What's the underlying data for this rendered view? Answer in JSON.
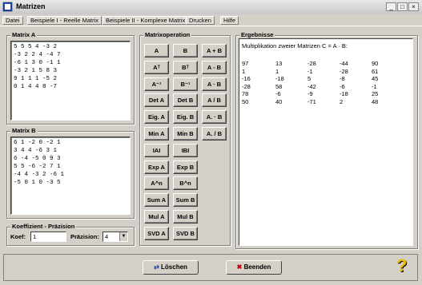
{
  "window": {
    "title": "Matrizen"
  },
  "menu": [
    "Datei",
    "Beispiele I - Reelle Matrix",
    "Beispiele II - Komplexe Matrix",
    "Drucken",
    "Hilfe"
  ],
  "matrix_a": {
    "title": "Matrix A",
    "content": "5 5 5 4 -3 2\n-3 2 2 4 -4 7\n-6 1 3 0 -1 1\n-3 2 1 5 8 3\n9 1 1 1 -5 2\n0 1 4 4 8 -7"
  },
  "matrix_b": {
    "title": "Matrix B",
    "content": "6 1 -2 0 -2 1\n3 4 4 -6 3 1\n6 -4 -5 0 9 3\n5 5 -6 -2 7 1\n-4 4 -3 2 -6 1\n-5 0 1 0 -3 5"
  },
  "operations": {
    "title": "Matrixoperation",
    "rows": [
      [
        "A",
        "B",
        "A + B"
      ],
      [
        "Aᵀ",
        "Bᵀ",
        "A - B"
      ],
      [
        "A⁻¹",
        "B⁻¹",
        "A · B"
      ],
      [
        "Det A",
        "Det B",
        "A / B"
      ],
      [
        "Eig. A",
        "Eig. B",
        "A. · B"
      ],
      [
        "Min A",
        "Min B",
        "A. / B"
      ],
      [
        "IAI",
        "IBI"
      ],
      [
        "Exp A",
        "Exp B"
      ],
      [
        "A^n",
        "B^n"
      ],
      [
        "Sum A",
        "Sum B"
      ],
      [
        "Mul A",
        "Mul B"
      ],
      [
        "SVD A",
        "SVD B"
      ]
    ]
  },
  "results": {
    "title": "Ergebnisse",
    "heading": "Multiplikation zweier Matrizen C = A · B:",
    "rows": [
      [
        "97",
        "13",
        "-28",
        "-44",
        "90"
      ],
      [
        "1",
        "1",
        "-1",
        "-28",
        "61"
      ],
      [
        "-16",
        "-18",
        "5",
        "-8",
        "45"
      ],
      [
        "-28",
        "58",
        "-42",
        "-6",
        "-1"
      ],
      [
        "78",
        "-6",
        "-9",
        "-18",
        "25"
      ],
      [
        "50",
        "40",
        "-71",
        "2",
        "48"
      ]
    ]
  },
  "precision": {
    "title": "Koeffizient - Präzision",
    "koef_label": "Koef:",
    "koef_value": "1",
    "praz_label": "Präzision:",
    "praz_value": "4"
  },
  "buttons": {
    "delete": "Löschen",
    "exit": "Beenden"
  },
  "icons": {
    "delete": "swap-arrows-icon",
    "exit": "exit-door-icon",
    "help": "help-question-icon"
  }
}
